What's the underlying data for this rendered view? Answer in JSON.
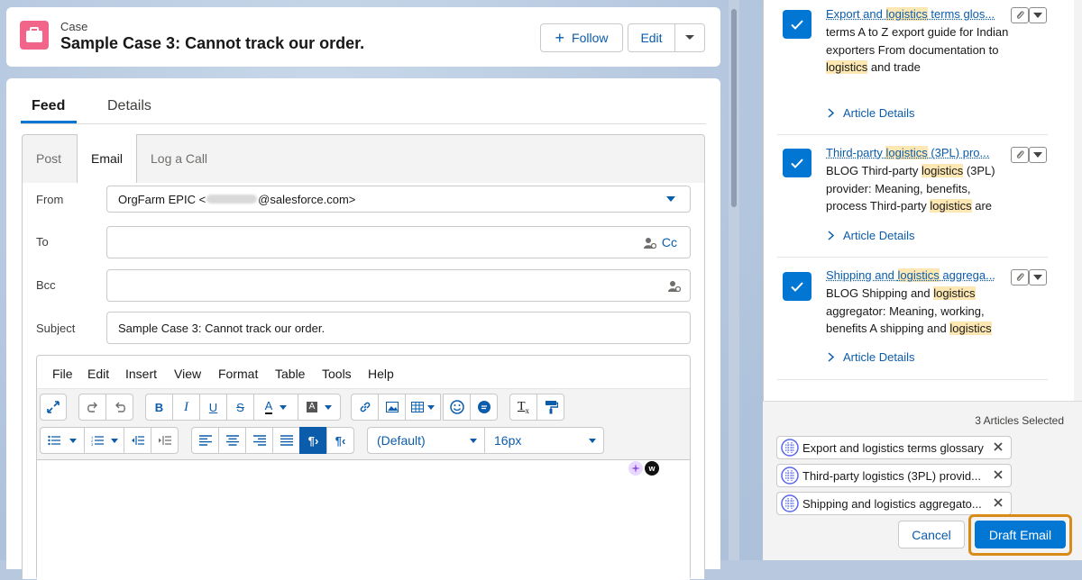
{
  "header": {
    "object_type": "Case",
    "title": "Sample Case 3: Cannot track our order.",
    "follow_label": "Follow",
    "edit_label": "Edit"
  },
  "tabs": {
    "feed": "Feed",
    "details": "Details"
  },
  "composer": {
    "tabs": {
      "post": "Post",
      "email": "Email",
      "log_call": "Log a Call"
    },
    "from_label": "From",
    "from_value_prefix": "OrgFarm EPIC <",
    "from_value_suffix": "@salesforce.com>",
    "to_label": "To",
    "cc_label": "Cc",
    "bcc_label": "Bcc",
    "subject_label": "Subject",
    "subject_value": "Sample Case 3: Cannot track our order."
  },
  "editor": {
    "menu": [
      "File",
      "Edit",
      "Insert",
      "View",
      "Format",
      "Table",
      "Tools",
      "Help"
    ],
    "font_family": "(Default)",
    "font_size": "16px"
  },
  "articles": [
    {
      "title_parts": [
        "Export and ",
        "logistics",
        " terms glos..."
      ],
      "summary_parts": [
        "terms A to Z export guide for Indian exporters From documentation to ",
        "logistics",
        " and trade"
      ],
      "details_label": "Article Details"
    },
    {
      "title_parts": [
        "Third-party ",
        "logistics",
        " (3PL) pro..."
      ],
      "summary_parts": [
        "BLOG Third-party ",
        "logistics",
        " (3PL) provider: Meaning, benefits, process Third-party ",
        "logistics",
        " are"
      ],
      "details_label": "Article Details"
    },
    {
      "title_parts": [
        "Shipping and ",
        "logistics",
        " aggrega..."
      ],
      "summary_parts": [
        "BLOG Shipping and ",
        "logistics",
        " aggregator: Meaning, working, benefits A shipping and ",
        "logistics"
      ],
      "details_label": "Article Details"
    }
  ],
  "selection": {
    "count_label": "3 Articles Selected",
    "selected": [
      "Export and logistics terms glossary",
      "Third-party logistics (3PL) provid...",
      "Shipping and logistics aggregato..."
    ],
    "cancel_label": "Cancel",
    "draft_label": "Draft Email"
  },
  "colors": {
    "brand_blue": "#0176d3",
    "link_blue": "#0b5cab",
    "case_icon_pink": "#f2658b",
    "highlight": "#fde8b4",
    "focus_orange": "#d98b1a"
  }
}
